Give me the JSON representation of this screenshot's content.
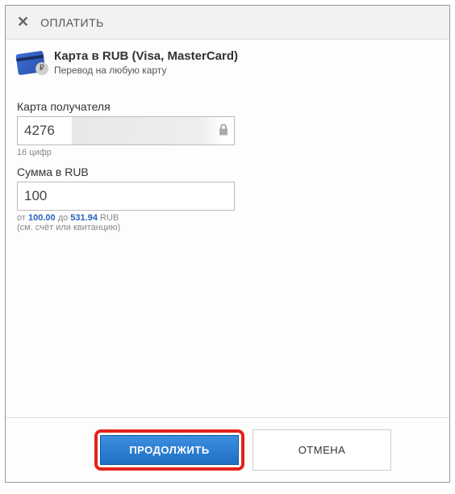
{
  "header": {
    "title": "ОПЛАТИТЬ"
  },
  "card": {
    "title": "Карта в RUB (Visa, MasterCard)",
    "subtitle": "Перевод на любую карту"
  },
  "recipient": {
    "label": "Карта получателя",
    "value": "4276",
    "hint": "16 цифр"
  },
  "amount": {
    "label": "Сумма в RUB",
    "value": "100",
    "hint_prefix": "от ",
    "min": "100.00",
    "hint_mid": " до ",
    "max": "531.94",
    "currency": " RUB",
    "hint_line2": "(см. счёт или квитанцию)"
  },
  "buttons": {
    "continue": "ПРОДОЛЖИТЬ",
    "cancel": "ОТМЕНА"
  }
}
